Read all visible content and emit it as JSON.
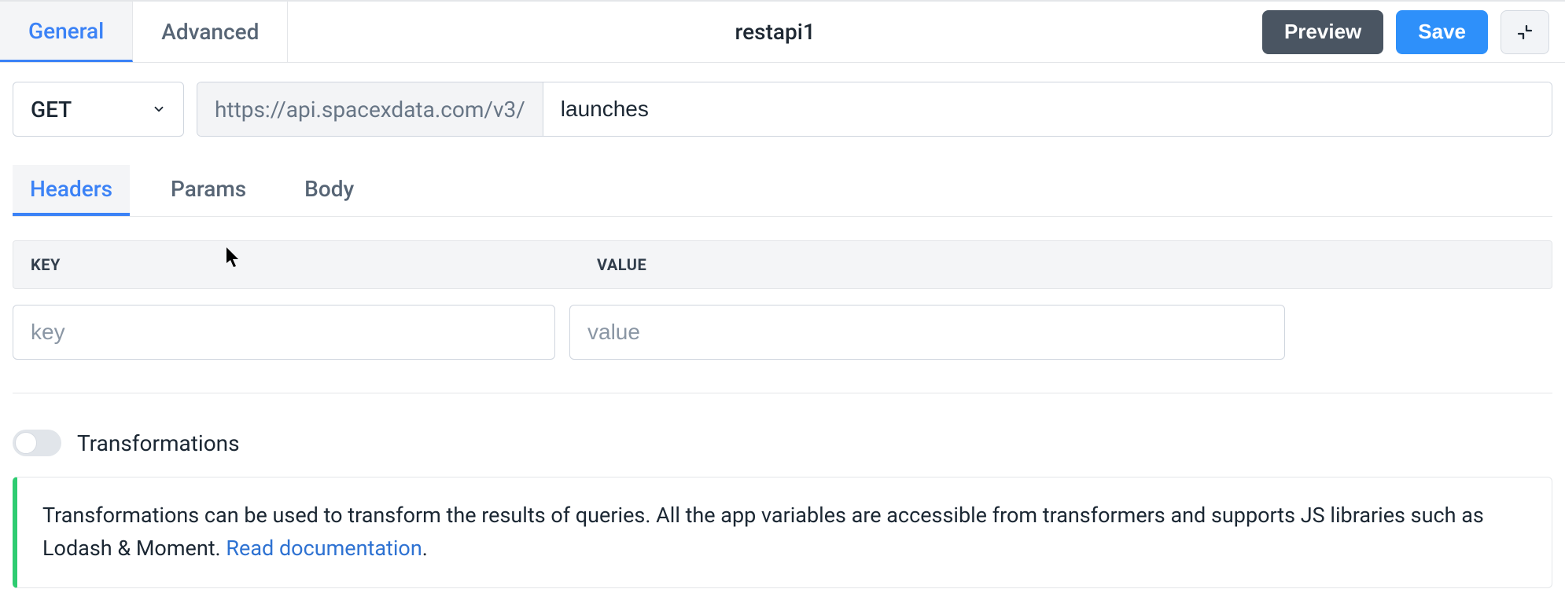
{
  "topTabs": {
    "general": "General",
    "advanced": "Advanced"
  },
  "title": "restapi1",
  "actions": {
    "preview": "Preview",
    "save": "Save"
  },
  "request": {
    "method": "GET",
    "baseUrl": "https://api.spacexdata.com/v3/",
    "path": "launches"
  },
  "subTabs": {
    "headers": "Headers",
    "params": "Params",
    "body": "Body"
  },
  "headersTable": {
    "colKey": "KEY",
    "colValue": "VALUE",
    "keyPlaceholder": "key",
    "valuePlaceholder": "value"
  },
  "transformations": {
    "label": "Transformations",
    "infoText": "Transformations can be used to transform the results of queries. All the app variables are accessible from transformers and supports JS libraries such as Lodash & Moment. ",
    "linkText": "Read documentation"
  }
}
